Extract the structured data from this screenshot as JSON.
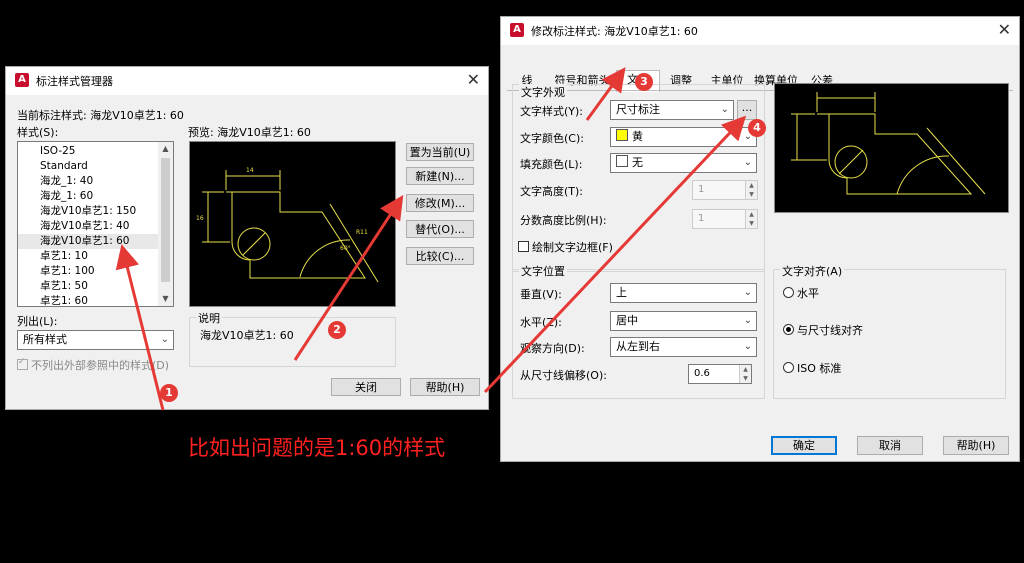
{
  "left_dialog": {
    "title": "标注样式管理器",
    "current_style_label": "当前标注样式: 海龙V10卓艺1: 60",
    "styles_label": "样式(S):",
    "preview_label": "预览: 海龙V10卓艺1: 60",
    "styles": [
      "ISO-25",
      "Standard",
      "海龙_1: 40",
      "海龙_1: 60",
      "海龙V10卓艺1: 150",
      "海龙V10卓艺1: 40",
      "海龙V10卓艺1: 60",
      "卓艺1: 10",
      "卓艺1: 100",
      "卓艺1: 50",
      "卓艺1: 60"
    ],
    "selected_style": "海龙V10卓艺1: 60",
    "list_label": "列出(L):",
    "list_value": "所有样式",
    "exclude_xref_label": "不列出外部参照中的样式(D)",
    "description_label": "说明",
    "description_text": "海龙V10卓艺1: 60",
    "buttons": {
      "set_current": "置为当前(U)",
      "new": "新建(N)...",
      "modify": "修改(M)...",
      "override": "替代(O)...",
      "compare": "比较(C)...",
      "close": "关闭",
      "help": "帮助(H)"
    }
  },
  "right_dialog": {
    "title": "修改标注样式: 海龙V10卓艺1: 60",
    "tabs": [
      "线",
      "符号和箭头",
      "文字",
      "调整",
      "主单位",
      "换算单位",
      "公差"
    ],
    "active_tab": "文字",
    "text_appearance": {
      "group_label": "文字外观",
      "text_style_label": "文字样式(Y):",
      "text_style_value": "尺寸标注",
      "browse_button": "...",
      "text_color_label": "文字颜色(C):",
      "text_color_value": "黄",
      "text_color_swatch": "#ffff00",
      "fill_color_label": "填充颜色(L):",
      "fill_color_value": "无",
      "text_height_label": "文字高度(T):",
      "text_height_value": "1",
      "fraction_scale_label": "分数高度比例(H):",
      "fraction_scale_value": "1",
      "draw_frame_label": "绘制文字边框(F)"
    },
    "text_placement": {
      "group_label": "文字位置",
      "vertical_label": "垂直(V):",
      "vertical_value": "上",
      "horizontal_label": "水平(Z):",
      "horizontal_value": "居中",
      "view_direction_label": "观察方向(D):",
      "view_direction_value": "从左到右",
      "offset_label": "从尺寸线偏移(O):",
      "offset_value": "0.6"
    },
    "text_alignment": {
      "group_label": "文字对齐(A)",
      "options": [
        "水平",
        "与尺寸线对齐",
        "ISO 标准"
      ],
      "selected": "与尺寸线对齐"
    },
    "buttons": {
      "ok": "确定",
      "cancel": "取消",
      "help": "帮助(H)"
    }
  },
  "annotations": {
    "caption": "比如出问题的是1:60的样式",
    "badges": [
      "1",
      "2",
      "3",
      "4"
    ],
    "color": "#e53935"
  }
}
